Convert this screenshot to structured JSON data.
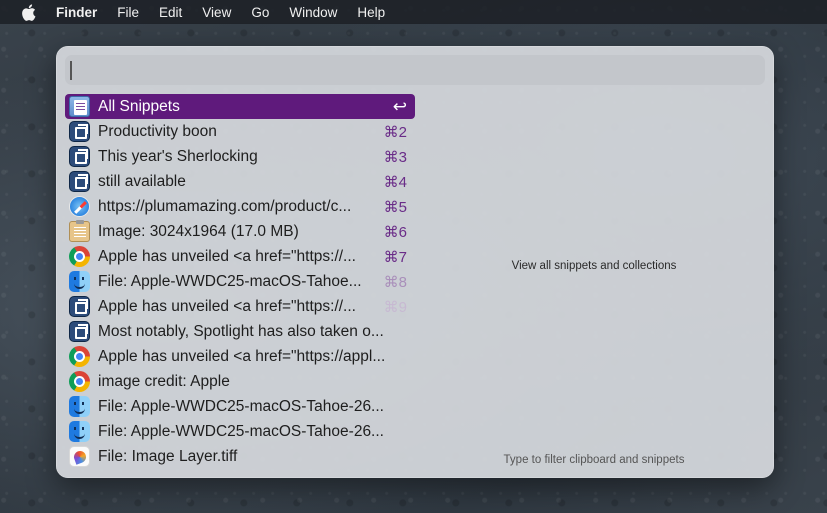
{
  "menubar": {
    "apple_icon": "apple-logo-icon",
    "app_name": "Finder",
    "items": [
      "File",
      "Edit",
      "View",
      "Go",
      "Window",
      "Help"
    ]
  },
  "search": {
    "value": "",
    "placeholder": ""
  },
  "list": [
    {
      "label": "All Snippets",
      "shortcut": "↩",
      "icon": "all-snippets-icon",
      "selected": true
    },
    {
      "label": "Productivity boon",
      "shortcut": "⌘2",
      "icon": "snippet-icon"
    },
    {
      "label": "This year's Sherlocking",
      "shortcut": "⌘3",
      "icon": "snippet-icon"
    },
    {
      "label": "still available",
      "shortcut": "⌘4",
      "icon": "snippet-icon"
    },
    {
      "label": "https://plumamazing.com/product/c...",
      "shortcut": "⌘5",
      "icon": "safari-icon"
    },
    {
      "label": "Image: 3024x1964 (17.0 MB)",
      "shortcut": "⌘6",
      "icon": "clipboard-icon"
    },
    {
      "label": "Apple has unveiled <a href=\"https://...",
      "shortcut": "⌘7",
      "icon": "chrome-icon"
    },
    {
      "label": "File: Apple-WWDC25-macOS-Tahoe...",
      "shortcut": "⌘8",
      "icon": "finder-icon"
    },
    {
      "label": "Apple has unveiled <a href=\"https://...",
      "shortcut": "⌘9",
      "icon": "snippet-icon"
    },
    {
      "label": "Most notably, Spotlight has also taken o...",
      "shortcut": "",
      "icon": "snippet-icon"
    },
    {
      "label": "Apple has unveiled <a href=\"https://appl...",
      "shortcut": "",
      "icon": "chrome-icon"
    },
    {
      "label": "image credit: Apple",
      "shortcut": "",
      "icon": "chrome-icon"
    },
    {
      "label": "File: Apple-WWDC25-macOS-Tahoe-26...",
      "shortcut": "",
      "icon": "finder-icon"
    },
    {
      "label": "File: Apple-WWDC25-macOS-Tahoe-26...",
      "shortcut": "",
      "icon": "finder-icon"
    },
    {
      "label": "File: Image Layer.tiff",
      "shortcut": "",
      "icon": "image-file-icon"
    }
  ],
  "preview": {
    "info": "View all snippets and collections",
    "hint": "Type to filter clipboard and snippets"
  },
  "colors": {
    "selection": "#5f1a7c",
    "shortcut": "#6a2c88"
  }
}
